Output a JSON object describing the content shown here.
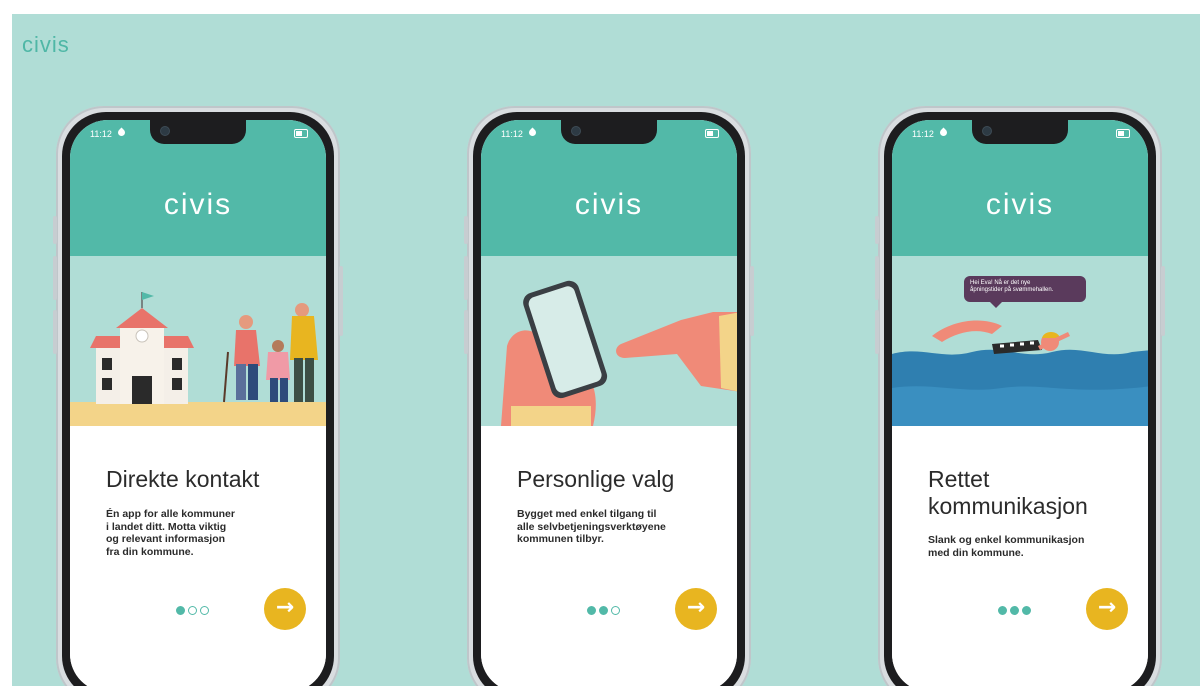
{
  "brand": "civis",
  "colors": {
    "background": "#b0ddd6",
    "header_teal": "#52b9a8",
    "accent_yellow": "#e8b520",
    "text_dark": "#2b2b2b",
    "bubble_purple": "#5a3a5c"
  },
  "phones": [
    {
      "status_time": "11:12",
      "logo": "civis",
      "title": "Direkte kontakt",
      "body_lines": [
        "Én app for alle kommuner",
        "i landet ditt. Motta viktig",
        "og relevant informasjon",
        "fra din kommune."
      ],
      "page_indicator": {
        "current": 1,
        "total": 3
      },
      "next_icon": "arrow-right-icon"
    },
    {
      "status_time": "11:12",
      "logo": "civis",
      "title": "Personlige valg",
      "body_lines": [
        "Bygget med enkel tilgang til",
        "alle selvbetjeningsverktøyene",
        "kommunen tilbyr."
      ],
      "page_indicator": {
        "current": 2,
        "total": 3
      },
      "next_icon": "arrow-right-icon"
    },
    {
      "status_time": "11:12",
      "logo": "civis",
      "title_lines": [
        "Rettet",
        "kommunikasjon"
      ],
      "body_lines": [
        "Slank og enkel kommunikasjon",
        "med din kommune."
      ],
      "bubble_lines": [
        "Hei Eva! Nå er det nye",
        "åpningstider på svømmehallen."
      ],
      "page_indicator": {
        "current": 3,
        "total": 3
      },
      "next_icon": "arrow-right-icon"
    }
  ]
}
